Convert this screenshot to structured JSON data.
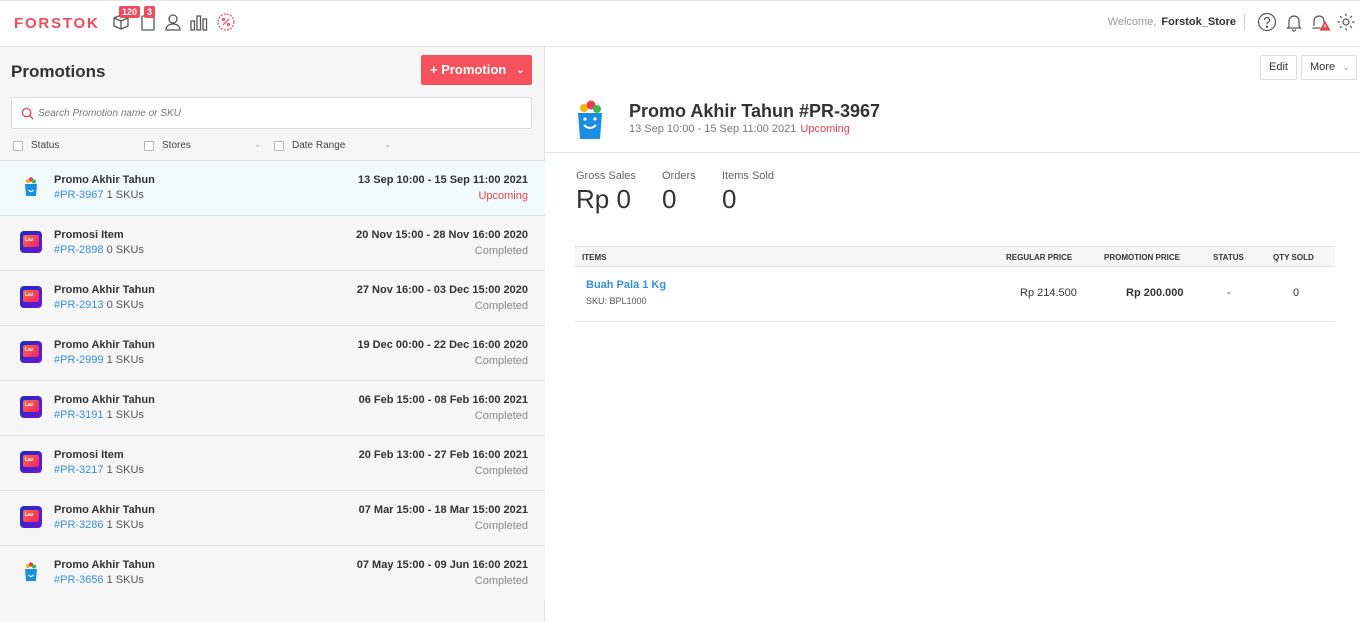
{
  "topbar": {
    "logo": "FORSTOK",
    "nav_icons": [
      {
        "name": "box-icon",
        "badge": "120"
      },
      {
        "name": "document-icon",
        "badge": "3"
      },
      {
        "name": "user-icon",
        "badge": ""
      },
      {
        "name": "bar-chart-icon",
        "badge": ""
      },
      {
        "name": "promotion-icon",
        "badge": ""
      }
    ],
    "welcome_text": "Welcome,",
    "username": "Forstok_Store",
    "right_icons": [
      "help-icon",
      "bell-icon",
      "alert-bell-icon",
      "settings-icon"
    ]
  },
  "sidebar": {
    "title": "Promotions",
    "add_button": "+ Promotion",
    "search_placeholder": "Search Promotion name or SKU",
    "filters": [
      {
        "label": "Status"
      },
      {
        "label": "Stores"
      },
      {
        "label": "Date Range"
      }
    ],
    "rows": [
      {
        "icon": "blibli",
        "name": "Promo Akhir Tahun",
        "code": "#PR-3967",
        "skus": "1 SKUs",
        "dates": "13 Sep 10:00 - 15 Sep 11:00 2021",
        "status": "Upcoming",
        "active": true
      },
      {
        "icon": "lazada",
        "name": "Promosi Item",
        "code": "#PR-2898",
        "skus": "0 SKUs",
        "dates": "20 Nov 15:00 - 28 Nov 16:00 2020",
        "status": "Completed",
        "active": false
      },
      {
        "icon": "lazada",
        "name": "Promo Akhir Tahun",
        "code": "#PR-2913",
        "skus": "0 SKUs",
        "dates": "27 Nov 16:00 - 03 Dec 15:00 2020",
        "status": "Completed",
        "active": false
      },
      {
        "icon": "lazada",
        "name": "Promo Akhir Tahun",
        "code": "#PR-2999",
        "skus": "1 SKUs",
        "dates": "19 Dec 00:00 - 22 Dec 16:00 2020",
        "status": "Completed",
        "active": false
      },
      {
        "icon": "lazada",
        "name": "Promo Akhir Tahun",
        "code": "#PR-3191",
        "skus": "1 SKUs",
        "dates": "06 Feb 15:00 - 08 Feb 16:00 2021",
        "status": "Completed",
        "active": false
      },
      {
        "icon": "lazada",
        "name": "Promosi Item",
        "code": "#PR-3217",
        "skus": "1 SKUs",
        "dates": "20 Feb 13:00 - 27 Feb 16:00 2021",
        "status": "Completed",
        "active": false
      },
      {
        "icon": "lazada",
        "name": "Promo Akhir Tahun",
        "code": "#PR-3286",
        "skus": "1 SKUs",
        "dates": "07 Mar 15:00 - 18 Mar 15:00 2021",
        "status": "Completed",
        "active": false
      },
      {
        "icon": "blibli",
        "name": "Promo Akhir Tahun",
        "code": "#PR-3656",
        "skus": "1 SKUs",
        "dates": "07 May 15:00 - 09 Jun 16:00 2021",
        "status": "Completed",
        "active": false
      }
    ]
  },
  "detail": {
    "edit_button": "Edit",
    "more_button": "More",
    "title": "Promo Akhir Tahun #PR-3967",
    "date_range": "13 Sep 10:00 - 15 Sep 11:00 2021",
    "status": "Upcoming",
    "stats": [
      {
        "label": "Gross Sales",
        "value": "Rp 0"
      },
      {
        "label": "Orders",
        "value": "0"
      },
      {
        "label": "Items Sold",
        "value": "0"
      }
    ],
    "table": {
      "headers": [
        "ITEMS",
        "REGULAR PRICE",
        "PROMOTION PRICE",
        "STATUS",
        "QTY SOLD"
      ],
      "rows": [
        {
          "item": "Buah Pala 1 Kg",
          "sku": "SKU: BPL1000",
          "regular_price": "Rp 214.500",
          "promotion_price": "Rp 200.000",
          "status": "-",
          "qty_sold": "0"
        }
      ]
    }
  },
  "colors": {
    "brand": "#ee4c5d",
    "link": "#3a8fd0",
    "active_row": "#f1fbfd"
  }
}
